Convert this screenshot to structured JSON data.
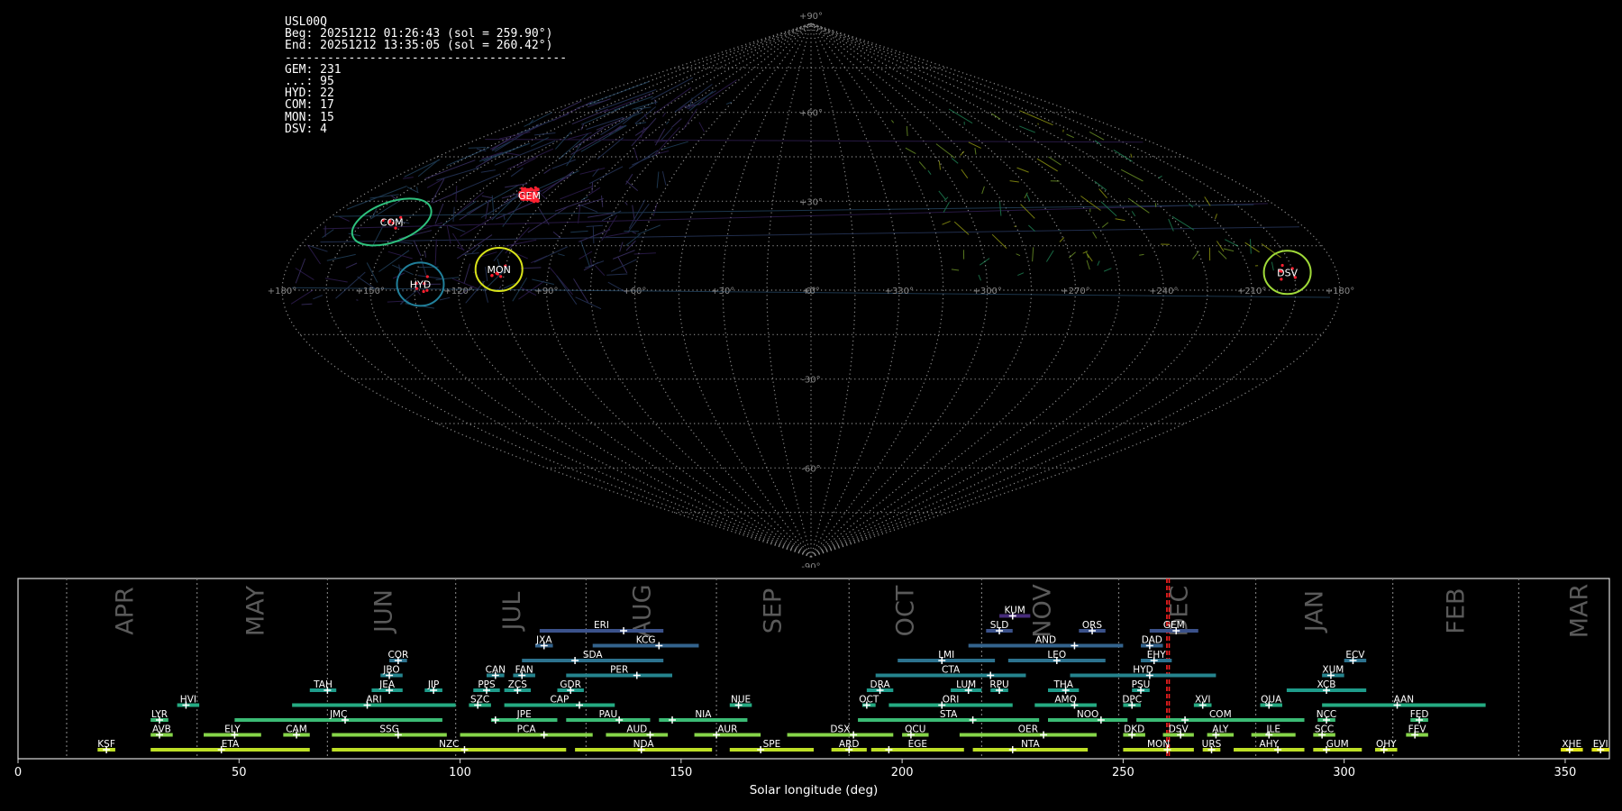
{
  "info": {
    "station": "USL00Q",
    "beg": "Beg: 20251212 01:26:43 (sol = 259.90°)",
    "end": "End: 20251212 13:35:05 (sol = 260.42°)",
    "separator": "----------------------------------------",
    "counts": [
      "GEM: 231",
      "...: 95",
      "HYD: 22",
      "COM: 17",
      "MON: 15",
      "DSV: 4"
    ]
  },
  "chart_data": [
    {
      "type": "scatter",
      "projection": "sinusoidal",
      "grid": true,
      "lat_ticks": [
        "+90°",
        "+60°",
        "+30°",
        "0°",
        "-30°",
        "-60°",
        "-90°"
      ],
      "lon_ticks": [
        "+180°",
        "+150°",
        "+120°",
        "+90°",
        "+60°",
        "+30°",
        "+0°",
        "+330°",
        "+300°",
        "+270°",
        "+240°",
        "+210°",
        "+180°"
      ],
      "lon_axis": "reversed, centered on 0°",
      "radiants": [
        {
          "name": "GEM",
          "lon": 113,
          "lat": 32,
          "color": "#ff2020",
          "circled": false
        },
        {
          "name": "COM",
          "lon": 155,
          "lat": 23,
          "color": "#2ec27e",
          "circled": true
        },
        {
          "name": "HYD",
          "lon": 133,
          "lat": 2,
          "color": "#21809b",
          "circled": true
        },
        {
          "name": "MON",
          "lon": 107,
          "lat": 7,
          "color": "#d8e219",
          "circled": true
        },
        {
          "name": "DSV",
          "lon": 197,
          "lat": 6,
          "color": "#a0da39",
          "circled": true
        }
      ]
    },
    {
      "type": "timeline",
      "xlabel": "Solar longitude (deg)",
      "xlim": [
        0,
        360
      ],
      "x_ticks": [
        0,
        50,
        100,
        150,
        200,
        250,
        300,
        350
      ],
      "months": [
        {
          "label": "APR",
          "x": 24.5
        },
        {
          "label": "MAY",
          "x": 54
        },
        {
          "label": "JUN",
          "x": 83
        },
        {
          "label": "JUL",
          "x": 112
        },
        {
          "label": "AUG",
          "x": 141.5
        },
        {
          "label": "SEP",
          "x": 171
        },
        {
          "label": "OCT",
          "x": 201
        },
        {
          "label": "NOV",
          "x": 232
        },
        {
          "label": "DEC",
          "x": 263
        },
        {
          "label": "JAN",
          "x": 293.5
        },
        {
          "label": "FEB",
          "x": 325.5
        },
        {
          "label": "MAR",
          "x": 353.5
        }
      ],
      "month_boundaries": [
        11,
        40.5,
        70,
        99,
        128.5,
        158,
        188,
        218,
        249,
        280,
        311,
        339.5
      ],
      "current_sol": [
        259.9,
        260.42
      ],
      "showers": [
        {
          "name": "KUM",
          "start": 222,
          "end": 229,
          "peak": 225,
          "row": 9,
          "color": "#472c7a"
        },
        {
          "name": "ERI",
          "start": 118,
          "end": 146,
          "peak": 137,
          "row": 8,
          "color": "#3b528b"
        },
        {
          "name": "SLD",
          "start": 219,
          "end": 225,
          "peak": 222,
          "row": 8,
          "color": "#3b528b"
        },
        {
          "name": "ORS",
          "start": 240,
          "end": 246,
          "peak": 243,
          "row": 8,
          "color": "#3b528b"
        },
        {
          "name": "GEM",
          "start": 256,
          "end": 267,
          "peak": 262,
          "row": 8,
          "color": "#3b528b"
        },
        {
          "name": "JXA",
          "start": 117,
          "end": 121,
          "peak": 119,
          "row": 7,
          "color": "#33638d"
        },
        {
          "name": "KCG",
          "start": 130,
          "end": 154,
          "peak": 145,
          "row": 7,
          "color": "#33638d"
        },
        {
          "name": "AND",
          "start": 215,
          "end": 250,
          "peak": 239,
          "row": 7,
          "color": "#33638d"
        },
        {
          "name": "DAD",
          "start": 254,
          "end": 259,
          "peak": 256,
          "row": 7,
          "color": "#33638d"
        },
        {
          "name": "COR",
          "start": 84,
          "end": 88,
          "peak": 86,
          "row": 6,
          "color": "#2c728e"
        },
        {
          "name": "SDA",
          "start": 114,
          "end": 146,
          "peak": 126,
          "row": 6,
          "color": "#2c728e"
        },
        {
          "name": "LMI",
          "start": 199,
          "end": 221,
          "peak": 209,
          "row": 6,
          "color": "#2c728e"
        },
        {
          "name": "LEO",
          "start": 224,
          "end": 246,
          "peak": 235,
          "row": 6,
          "color": "#2c728e"
        },
        {
          "name": "EHY",
          "start": 254,
          "end": 261,
          "peak": 257,
          "row": 6,
          "color": "#2c728e"
        },
        {
          "name": "ECV",
          "start": 300,
          "end": 305,
          "peak": 302,
          "row": 6,
          "color": "#2c728e"
        },
        {
          "name": "JBO",
          "start": 82,
          "end": 87,
          "peak": 84,
          "row": 5,
          "color": "#25848e"
        },
        {
          "name": "CAN",
          "start": 106,
          "end": 110,
          "peak": 108,
          "row": 5,
          "color": "#25848e"
        },
        {
          "name": "FAN",
          "start": 112,
          "end": 117,
          "peak": 114,
          "row": 5,
          "color": "#25848e"
        },
        {
          "name": "PER",
          "start": 124,
          "end": 148,
          "peak": 140,
          "row": 5,
          "color": "#25848e"
        },
        {
          "name": "CTA",
          "start": 194,
          "end": 228,
          "peak": 220,
          "row": 5,
          "color": "#25848e"
        },
        {
          "name": "HYD",
          "start": 238,
          "end": 271,
          "peak": 256,
          "row": 5,
          "color": "#25848e"
        },
        {
          "name": "XUM",
          "start": 295,
          "end": 300,
          "peak": 297,
          "row": 5,
          "color": "#25848e"
        },
        {
          "name": "TAH",
          "start": 66,
          "end": 72,
          "peak": 70,
          "row": 4,
          "color": "#1e9b8a"
        },
        {
          "name": "JEA",
          "start": 80,
          "end": 87,
          "peak": 84,
          "row": 4,
          "color": "#1e9b8a"
        },
        {
          "name": "JIP",
          "start": 92,
          "end": 96,
          "peak": 94,
          "row": 4,
          "color": "#1e9b8a"
        },
        {
          "name": "PPS",
          "start": 103,
          "end": 109,
          "peak": 106,
          "row": 4,
          "color": "#1e9b8a"
        },
        {
          "name": "ZCS",
          "start": 110,
          "end": 116,
          "peak": 113,
          "row": 4,
          "color": "#1e9b8a"
        },
        {
          "name": "GDR",
          "start": 122,
          "end": 128,
          "peak": 125,
          "row": 4,
          "color": "#1e9b8a"
        },
        {
          "name": "DRA",
          "start": 192,
          "end": 198,
          "peak": 195,
          "row": 4,
          "color": "#1e9b8a"
        },
        {
          "name": "LUM",
          "start": 211,
          "end": 218,
          "peak": 215,
          "row": 4,
          "color": "#1e9b8a"
        },
        {
          "name": "RPU",
          "start": 220,
          "end": 224,
          "peak": 222,
          "row": 4,
          "color": "#1e9b8a"
        },
        {
          "name": "THA",
          "start": 233,
          "end": 240,
          "peak": 237,
          "row": 4,
          "color": "#1e9b8a"
        },
        {
          "name": "PSU",
          "start": 252,
          "end": 256,
          "peak": 254,
          "row": 4,
          "color": "#1e9b8a"
        },
        {
          "name": "XCB",
          "start": 287,
          "end": 305,
          "peak": 296,
          "row": 4,
          "color": "#1e9b8a"
        },
        {
          "name": "HVI",
          "start": 36,
          "end": 41,
          "peak": 38,
          "row": 3,
          "color": "#25ab82"
        },
        {
          "name": "ARI",
          "start": 62,
          "end": 99,
          "peak": 79,
          "row": 3,
          "color": "#25ab82"
        },
        {
          "name": "SZC",
          "start": 102,
          "end": 107,
          "peak": 104,
          "row": 3,
          "color": "#25ab82"
        },
        {
          "name": "CAP",
          "start": 110,
          "end": 135,
          "peak": 127,
          "row": 3,
          "color": "#25ab82"
        },
        {
          "name": "NUE",
          "start": 161,
          "end": 166,
          "peak": 163,
          "row": 3,
          "color": "#25ab82"
        },
        {
          "name": "OCT",
          "start": 191,
          "end": 194,
          "peak": 192,
          "row": 3,
          "color": "#25ab82"
        },
        {
          "name": "ORI",
          "start": 197,
          "end": 225,
          "peak": 209,
          "row": 3,
          "color": "#25ab82"
        },
        {
          "name": "AMO",
          "start": 230,
          "end": 244,
          "peak": 239,
          "row": 3,
          "color": "#25ab82"
        },
        {
          "name": "DPC",
          "start": 250,
          "end": 254,
          "peak": 252,
          "row": 3,
          "color": "#25ab82"
        },
        {
          "name": "XVI",
          "start": 266,
          "end": 270,
          "peak": 268,
          "row": 3,
          "color": "#25ab82"
        },
        {
          "name": "QUA",
          "start": 281,
          "end": 286,
          "peak": 283,
          "row": 3,
          "color": "#25ab82"
        },
        {
          "name": "AAN",
          "start": 295,
          "end": 332,
          "peak": 312,
          "row": 3,
          "color": "#25ab82"
        },
        {
          "name": "LYR",
          "start": 30,
          "end": 34,
          "peak": 32,
          "row": 2,
          "color": "#3bbb75"
        },
        {
          "name": "JMC",
          "start": 49,
          "end": 96,
          "peak": 74,
          "row": 2,
          "color": "#3bbb75"
        },
        {
          "name": "JPE",
          "start": 107,
          "end": 122,
          "peak": 108,
          "row": 2,
          "color": "#3bbb75"
        },
        {
          "name": "PAU",
          "start": 124,
          "end": 143,
          "peak": 136,
          "row": 2,
          "color": "#3bbb75"
        },
        {
          "name": "NIA",
          "start": 145,
          "end": 165,
          "peak": 148,
          "row": 2,
          "color": "#3bbb75"
        },
        {
          "name": "STA",
          "start": 190,
          "end": 231,
          "peak": 216,
          "row": 2,
          "color": "#3bbb75"
        },
        {
          "name": "NOO",
          "start": 233,
          "end": 251,
          "peak": 245,
          "row": 2,
          "color": "#3bbb75"
        },
        {
          "name": "COM",
          "start": 253,
          "end": 291,
          "peak": 264,
          "row": 2,
          "color": "#3bbb75"
        },
        {
          "name": "NCC",
          "start": 294,
          "end": 298,
          "peak": 296,
          "row": 2,
          "color": "#3bbb75"
        },
        {
          "name": "FED",
          "start": 315,
          "end": 319,
          "peak": 317,
          "row": 2,
          "color": "#3bbb75"
        },
        {
          "name": "AVB",
          "start": 30,
          "end": 35,
          "peak": 32,
          "row": 1,
          "color": "#86d549"
        },
        {
          "name": "ELY",
          "start": 42,
          "end": 55,
          "peak": 49,
          "row": 1,
          "color": "#86d549"
        },
        {
          "name": "CAM",
          "start": 60,
          "end": 66,
          "peak": 63,
          "row": 1,
          "color": "#86d549"
        },
        {
          "name": "SSG",
          "start": 71,
          "end": 97,
          "peak": 86,
          "row": 1,
          "color": "#86d549"
        },
        {
          "name": "PCA",
          "start": 100,
          "end": 130,
          "peak": 119,
          "row": 1,
          "color": "#86d549"
        },
        {
          "name": "AUD",
          "start": 133,
          "end": 147,
          "peak": 143,
          "row": 1,
          "color": "#86d549"
        },
        {
          "name": "AUR",
          "start": 153,
          "end": 168,
          "peak": 158,
          "row": 1,
          "color": "#86d549"
        },
        {
          "name": "DSX",
          "start": 174,
          "end": 198,
          "peak": 189,
          "row": 1,
          "color": "#86d549"
        },
        {
          "name": "OCU",
          "start": 200,
          "end": 206,
          "peak": 202,
          "row": 1,
          "color": "#86d549"
        },
        {
          "name": "OER",
          "start": 213,
          "end": 244,
          "peak": 232,
          "row": 1,
          "color": "#86d549"
        },
        {
          "name": "DKD",
          "start": 250,
          "end": 255,
          "peak": 252,
          "row": 1,
          "color": "#86d549"
        },
        {
          "name": "DSV",
          "start": 259,
          "end": 266,
          "peak": 263,
          "row": 1,
          "color": "#86d549"
        },
        {
          "name": "ALY",
          "start": 269,
          "end": 275,
          "peak": 271,
          "row": 1,
          "color": "#86d549"
        },
        {
          "name": "JLE",
          "start": 279,
          "end": 289,
          "peak": 283,
          "row": 1,
          "color": "#86d549"
        },
        {
          "name": "SCC",
          "start": 293,
          "end": 298,
          "peak": 295,
          "row": 1,
          "color": "#86d549"
        },
        {
          "name": "FEV",
          "start": 314,
          "end": 319,
          "peak": 316,
          "row": 1,
          "color": "#86d549"
        },
        {
          "name": "KSF",
          "start": 18,
          "end": 22,
          "peak": 20,
          "row": 0,
          "color": "#bddf26"
        },
        {
          "name": "ETA",
          "start": 30,
          "end": 66,
          "peak": 46,
          "row": 0,
          "color": "#bddf26"
        },
        {
          "name": "NZC",
          "start": 71,
          "end": 124,
          "peak": 101,
          "row": 0,
          "color": "#bddf26"
        },
        {
          "name": "NDA",
          "start": 126,
          "end": 157,
          "peak": 141,
          "row": 0,
          "color": "#bddf26"
        },
        {
          "name": "SPE",
          "start": 161,
          "end": 180,
          "peak": 168,
          "row": 0,
          "color": "#bddf26"
        },
        {
          "name": "ARD",
          "start": 184,
          "end": 192,
          "peak": 188,
          "row": 0,
          "color": "#bddf26"
        },
        {
          "name": "EGE",
          "start": 193,
          "end": 214,
          "peak": 197,
          "row": 0,
          "color": "#bddf26"
        },
        {
          "name": "NTA",
          "start": 216,
          "end": 242,
          "peak": 225,
          "row": 0,
          "color": "#bddf26"
        },
        {
          "name": "MON",
          "start": 250,
          "end": 266,
          "peak": 260,
          "row": 0,
          "color": "#bddf26"
        },
        {
          "name": "URS",
          "start": 268,
          "end": 272,
          "peak": 270,
          "row": 0,
          "color": "#bddf26"
        },
        {
          "name": "AHY",
          "start": 275,
          "end": 291,
          "peak": 285,
          "row": 0,
          "color": "#bddf26"
        },
        {
          "name": "GUM",
          "start": 293,
          "end": 304,
          "peak": 296,
          "row": 0,
          "color": "#bddf26"
        },
        {
          "name": "OHY",
          "start": 307,
          "end": 312,
          "peak": 309,
          "row": 0,
          "color": "#bddf26"
        },
        {
          "name": "XHE",
          "start": 349,
          "end": 354,
          "peak": 351,
          "row": 0,
          "color": "#dde318"
        },
        {
          "name": "EVI",
          "start": 356,
          "end": 360,
          "peak": 358,
          "row": 0,
          "color": "#dde318"
        }
      ]
    }
  ]
}
